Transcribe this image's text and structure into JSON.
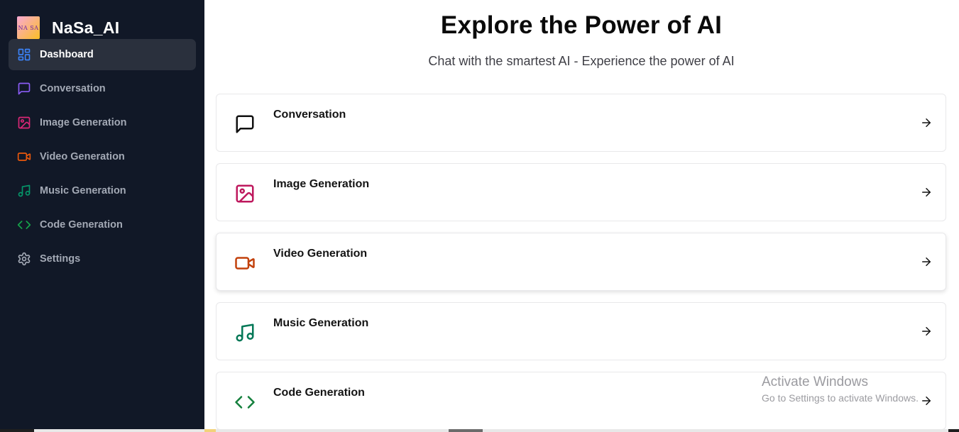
{
  "brand": {
    "logo_text": "NA SA",
    "name": "NaSa_AI"
  },
  "sidebar": {
    "items": [
      {
        "label": "Dashboard",
        "icon": "layout-dashboard-icon",
        "color": "#3b82f6",
        "active": true
      },
      {
        "label": "Conversation",
        "icon": "message-square-icon",
        "color": "#8b5cf6",
        "active": false
      },
      {
        "label": "Image Generation",
        "icon": "image-icon",
        "color": "#db2777",
        "active": false
      },
      {
        "label": "Video Generation",
        "icon": "video-icon",
        "color": "#ea580c",
        "active": false
      },
      {
        "label": "Music Generation",
        "icon": "music-icon",
        "color": "#059669",
        "active": false
      },
      {
        "label": "Code Generation",
        "icon": "code-icon",
        "color": "#16a34a",
        "active": false
      },
      {
        "label": "Settings",
        "icon": "settings-icon",
        "color": "#a3a9b5",
        "active": false
      }
    ]
  },
  "main": {
    "title": "Explore the Power of AI",
    "subtitle": "Chat with the smartest AI - Experience the power of AI",
    "cards": [
      {
        "label": "Conversation",
        "icon": "message-square-icon",
        "color": "#111111"
      },
      {
        "label": "Image Generation",
        "icon": "image-icon",
        "color": "#be185d"
      },
      {
        "label": "Video Generation",
        "icon": "video-icon",
        "color": "#c2410c"
      },
      {
        "label": "Music Generation",
        "icon": "music-icon",
        "color": "#047857"
      },
      {
        "label": "Code Generation",
        "icon": "code-icon",
        "color": "#15803d"
      }
    ]
  },
  "watermark": {
    "title": "Activate Windows",
    "subtitle": "Go to Settings to activate Windows."
  }
}
